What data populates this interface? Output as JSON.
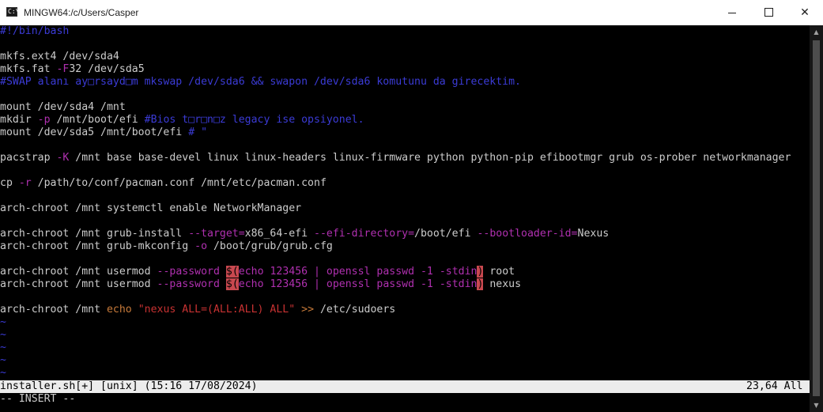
{
  "window": {
    "title": "MINGW64:/c/Users/Casper",
    "icon_label": "C:\\",
    "buttons": {
      "minimize": "minimize",
      "maximize": "maximize",
      "close": "✕"
    }
  },
  "colors": {
    "comment": "#3b3bd6",
    "option": "#b030b0",
    "string": "#c83232",
    "keyword": "#c77a3a",
    "highlight": "#c8484f"
  },
  "editor": {
    "lines": [
      [
        {
          "t": "#!/bin/bash",
          "c": "comment"
        }
      ],
      [],
      [
        {
          "t": "mkfs.ext4 /dev/sda4"
        }
      ],
      [
        {
          "t": "mkfs.fat "
        },
        {
          "t": "-F",
          "c": "option"
        },
        {
          "t": "32 /dev/sda5"
        }
      ],
      [
        {
          "t": "#SWAP alanı ay□rsayd□m mkswap /dev/sda6 && swapon /dev/sda6 komutunu da girecektim.",
          "c": "comment"
        }
      ],
      [],
      [
        {
          "t": "mount /dev/sda4 /mnt"
        }
      ],
      [
        {
          "t": "mkdir "
        },
        {
          "t": "-p",
          "c": "option"
        },
        {
          "t": " /mnt/boot/efi "
        },
        {
          "t": "#Bios t□r□n□z legacy ise opsiyonel.",
          "c": "comment"
        }
      ],
      [
        {
          "t": "mount /dev/sda5 /mnt/boot/efi "
        },
        {
          "t": "# \"",
          "c": "comment"
        }
      ],
      [],
      [
        {
          "t": "pacstrap "
        },
        {
          "t": "-K",
          "c": "option"
        },
        {
          "t": " /mnt base base-devel linux linux-headers linux-firmware python python-pip efibootmgr grub os-prober networkmanager"
        }
      ],
      [],
      [
        {
          "t": "cp "
        },
        {
          "t": "-r",
          "c": "option"
        },
        {
          "t": " /path/to/conf/pacman.conf /mnt/etc/pacman.conf"
        }
      ],
      [],
      [
        {
          "t": "arch-chroot /mnt systemctl enable NetworkManager"
        }
      ],
      [],
      [
        {
          "t": "arch-chroot /mnt grub-install "
        },
        {
          "t": "--target=",
          "c": "option"
        },
        {
          "t": "x86_64-efi "
        },
        {
          "t": "--efi-directory=",
          "c": "option"
        },
        {
          "t": "/boot/efi "
        },
        {
          "t": "--bootloader-id=",
          "c": "option"
        },
        {
          "t": "Nexus"
        }
      ],
      [
        {
          "t": "arch-chroot /mnt grub-mkconfig "
        },
        {
          "t": "-o",
          "c": "option"
        },
        {
          "t": " /boot/grub/grub.cfg"
        }
      ],
      [],
      [
        {
          "t": "arch-chroot /mnt usermod "
        },
        {
          "t": "--password",
          "c": "option"
        },
        {
          "t": " "
        },
        {
          "t": "$(",
          "c": "hl"
        },
        {
          "t": "echo 123456 | openssl passwd -1 -stdin",
          "c": "option"
        },
        {
          "t": ")",
          "c": "hl"
        },
        {
          "t": " root"
        }
      ],
      [
        {
          "t": "arch-chroot /mnt usermod "
        },
        {
          "t": "--password",
          "c": "option"
        },
        {
          "t": " "
        },
        {
          "t": "$(",
          "c": "hl"
        },
        {
          "t": "echo 123456 | openssl passwd -1 -stdin",
          "c": "option"
        },
        {
          "t": ")",
          "c": "hl"
        },
        {
          "t": " nexus"
        }
      ],
      [],
      [
        {
          "t": "arch-chroot /mnt "
        },
        {
          "t": "echo ",
          "c": "keyword"
        },
        {
          "t": "\"nexus ALL=(ALL:ALL) ALL\"",
          "c": "string"
        },
        {
          "t": " "
        },
        {
          "t": ">>",
          "c": "keyword"
        },
        {
          "t": " /etc/sudoers"
        }
      ],
      [
        {
          "t": "~",
          "c": "tilde"
        }
      ],
      [
        {
          "t": "~",
          "c": "tilde"
        }
      ],
      [
        {
          "t": "~",
          "c": "tilde"
        }
      ],
      [
        {
          "t": "~",
          "c": "tilde"
        }
      ],
      [
        {
          "t": "~",
          "c": "tilde"
        }
      ]
    ]
  },
  "statusline": {
    "left": "installer.sh[+] [unix] (15:16 17/08/2024)",
    "right": "23,64 All"
  },
  "cmdline": "-- INSERT --"
}
